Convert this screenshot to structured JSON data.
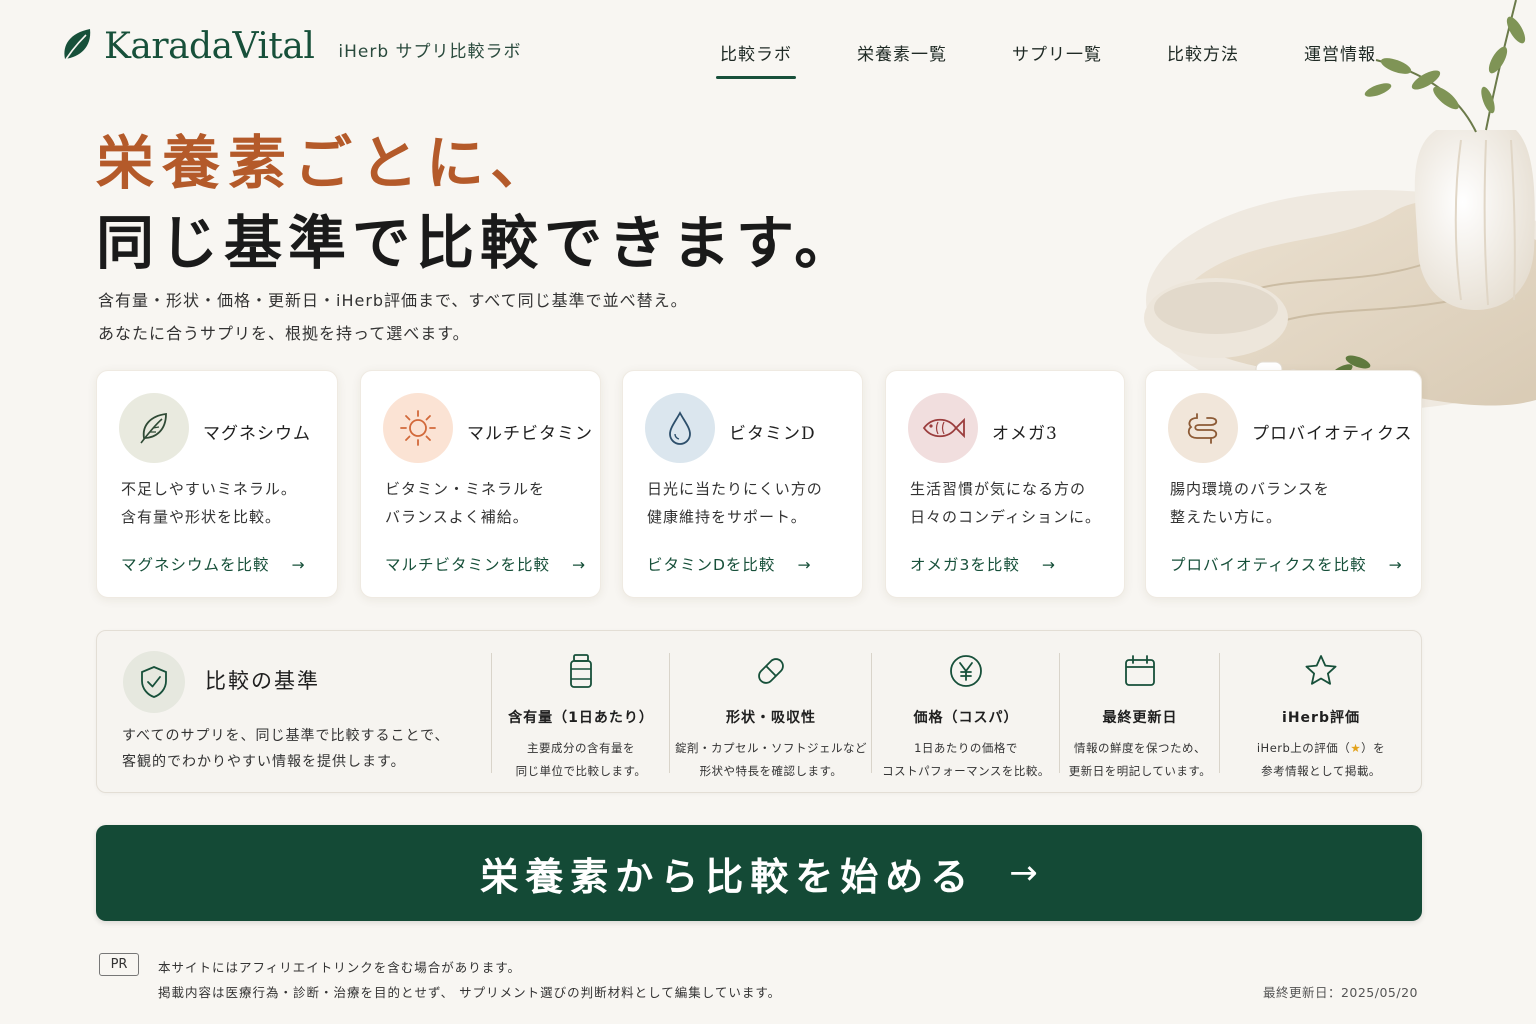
{
  "brand": {
    "name": "KaradaVital",
    "subtitle": "iHerb サプリ比較ラボ",
    "logo_icon": "leaf-icon",
    "color": "#17503a"
  },
  "nav": {
    "items": [
      {
        "label": "比較ラボ",
        "active": true
      },
      {
        "label": "栄養素一覧",
        "active": false
      },
      {
        "label": "サプリ一覧",
        "active": false
      },
      {
        "label": "比較方法",
        "active": false
      },
      {
        "label": "運営情報",
        "active": false
      }
    ]
  },
  "hero": {
    "line1": "栄養素ごとに、",
    "line2": "同じ基準で比較できます。",
    "lead1": "含有量・形状・価格・更新日・iHerb評価まで、すべて同じ基準で並べ替え。",
    "lead2": "あなたに合うサプリを、根拠を持って選べます。",
    "accent_color": "#b45a2a"
  },
  "cards": [
    {
      "title": "マグネシウム",
      "desc1": "不足しやすいミネラル。",
      "desc2": "含有量や形状を比較。",
      "link": "マグネシウムを比較",
      "icon": "leaf-icon",
      "bg": "#e9eadf",
      "stroke": "#2f4a35"
    },
    {
      "title": "マルチビタミン",
      "desc1": "ビタミン・ミネラルを",
      "desc2": "バランスよく補給。",
      "link": "マルチビタミンを比較",
      "icon": "sun-icon",
      "bg": "#fbe3d4",
      "stroke": "#d2693a"
    },
    {
      "title": "ビタミンD",
      "desc1": "日光に当たりにくい方の",
      "desc2": "健康維持をサポート。",
      "link": "ビタミンDを比較",
      "icon": "drop-icon",
      "bg": "#dbe6ee",
      "stroke": "#2d4f6b"
    },
    {
      "title": "オメガ3",
      "desc1": "生活習慣が気になる方の",
      "desc2": "日々のコンディションに。",
      "link": "オメガ3を比較",
      "icon": "fish-icon",
      "bg": "#f1dede",
      "stroke": "#9b3d3d"
    },
    {
      "title": "プロバイオティクス",
      "desc1": "腸内環境のバランスを",
      "desc2": "整えたい方に。",
      "link": "プロバイオティクスを比較",
      "icon": "gut-icon",
      "bg": "#f1e6da",
      "stroke": "#8c5a35"
    }
  ],
  "criteria": {
    "title": "比較の基準",
    "desc1": "すべてのサプリを、同じ基準で比較することで、",
    "desc2": "客観的でわかりやすい情報を提供します。",
    "items": [
      {
        "title": "含有量（1日あたり）",
        "d1": "主要成分の含有量を",
        "d2": "同じ単位で比較します。",
        "icon": "bottle-icon"
      },
      {
        "title": "形状・吸収性",
        "d1": "錠剤・カプセル・ソフトジェルなど",
        "d2": "形状や特長を確認します。",
        "icon": "capsule-icon"
      },
      {
        "title": "価格（コスパ）",
        "d1": "1日あたりの価格で",
        "d2": "コストパフォーマンスを比較。",
        "icon": "yen-icon"
      },
      {
        "title": "最終更新日",
        "d1": "情報の鮮度を保つため、",
        "d2": "更新日を明記しています。",
        "icon": "calendar-icon"
      },
      {
        "title": "iHerb評価",
        "d1a": "iHerb上の評価（",
        "d1b": "）を",
        "d2": "参考情報として掲載。",
        "icon": "star-icon"
      }
    ]
  },
  "cta": {
    "label": "栄養素から比較を始める",
    "arrow": "→"
  },
  "footer": {
    "pr_badge": "PR",
    "note1": "本サイトにはアフィリエイトリンクを含む場合があります。",
    "note2": "掲載内容は医療行為・診断・治療を目的とせず、 サプリメント選びの判断材料として編集しています。",
    "updated": "最終更新日：2025/05/20"
  }
}
